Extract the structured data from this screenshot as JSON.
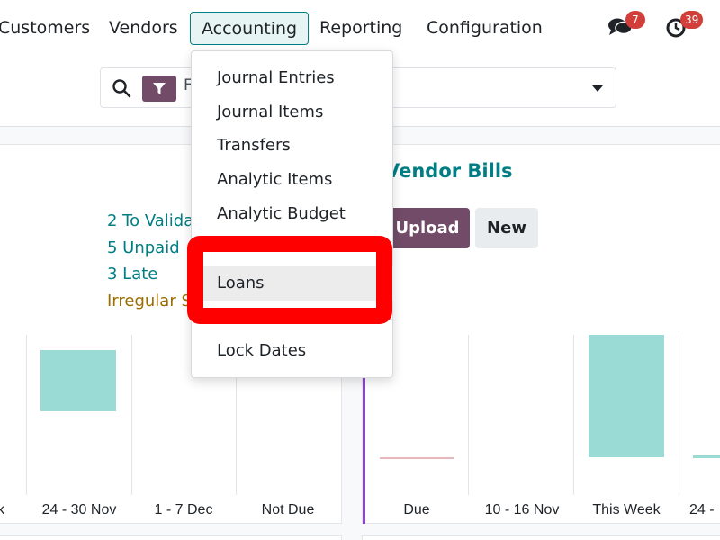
{
  "nav": {
    "items": [
      "Customers",
      "Vendors",
      "Accounting",
      "Reporting",
      "Configuration"
    ],
    "active": "Accounting"
  },
  "systray": {
    "messages_count": "7",
    "activities_count": "39"
  },
  "search": {
    "facet_partial": "F"
  },
  "accounting_menu": {
    "items": [
      "Journal Entries",
      "Journal Items",
      "Transfers",
      "Analytic Items",
      "Analytic Budget",
      "Loans",
      "Lock Dates"
    ],
    "highlighted": "Loans"
  },
  "left_card": {
    "stats": [
      "2 To Valida",
      "5 Unpaid",
      "3 Late",
      "Irregular S"
    ],
    "x_labels": [
      "k",
      "24 - 30 Nov",
      "1 - 7 Dec",
      "Not Due"
    ]
  },
  "vendor_bills": {
    "title": "Vendor Bills",
    "upload_label": "Upload",
    "new_label": "New",
    "x_labels": [
      "Due",
      "10 - 16 Nov",
      "This Week",
      "24 -"
    ]
  },
  "colors": {
    "brand": "#714b67",
    "accent": "#017e84",
    "bar": "#9adbd6",
    "badge": "#d23f3a",
    "annotation": "#ff0000"
  }
}
